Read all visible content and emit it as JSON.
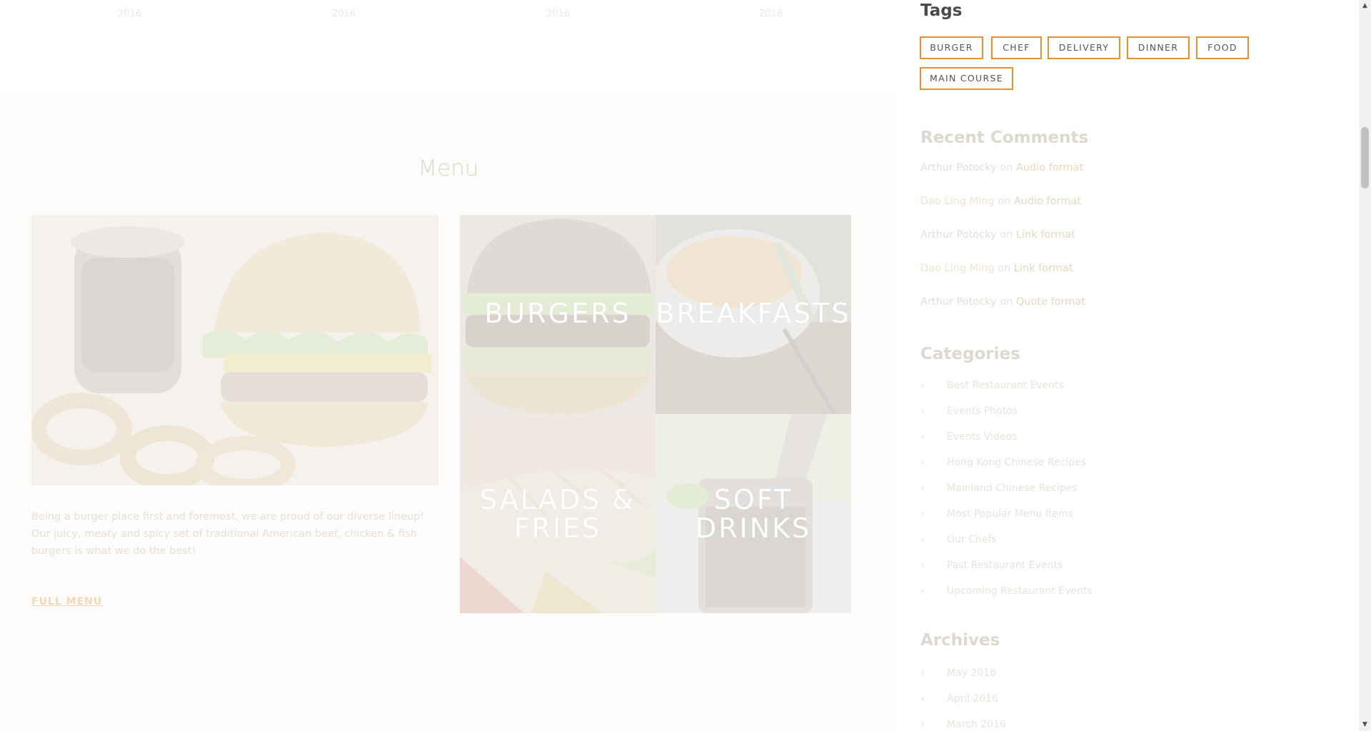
{
  "years": [
    "2016",
    "2016",
    "2016",
    "2016"
  ],
  "menu": {
    "heading": "Menu",
    "description": "Being a burger place first and foremost, we are proud of our diverse lineup! Our juicy, meaty and spicy set of traditional American beef, chicken & fish burgers is what we do the best!",
    "full_menu_label": "FULL MENU",
    "tiles": [
      {
        "label_line1": "BURGERS",
        "label_line2": ""
      },
      {
        "label_line1": "BREAKFASTS",
        "label_line2": ""
      },
      {
        "label_line1": "SALADS &",
        "label_line2": "FRIES"
      },
      {
        "label_line1": "SOFT",
        "label_line2": "DRINKS"
      }
    ]
  },
  "sidebar": {
    "tags_title": "Tags",
    "tags": [
      "BURGER",
      "CHEF",
      "DELIVERY",
      "DINNER",
      "FOOD",
      "MAIN COURSE"
    ],
    "recent_comments_title": "Recent Comments",
    "comments": [
      {
        "author": "Arthur Potocky",
        "on": "on",
        "post": "Audio format"
      },
      {
        "author": "Dao Ling Ming",
        "on": "on",
        "post": "Audio format"
      },
      {
        "author": "Arthur Potocky",
        "on": "on",
        "post": "Link format"
      },
      {
        "author": "Dao Ling Ming",
        "on": "on",
        "post": "Link format"
      },
      {
        "author": "Arthur Potocky",
        "on": "on",
        "post": "Quote format"
      }
    ],
    "categories_title": "Categories",
    "categories": [
      "Best Restaurant Events",
      "Events Photos",
      "Events Videos",
      "Hong Kong Chinese Recipes",
      "Mainland Chinese Recipes",
      "Most Popular Menu Items",
      "Our Chefs",
      "Past Restaurant Events",
      "Upcoming Restaurant Events"
    ],
    "archives_title": "Archives",
    "archives": [
      "May 2016",
      "April 2016",
      "March 2016"
    ]
  },
  "colors": {
    "tag_border": "#e6912e",
    "faded_text": "#e3dfd8",
    "scroll_thumb": "#c1c1c1"
  }
}
